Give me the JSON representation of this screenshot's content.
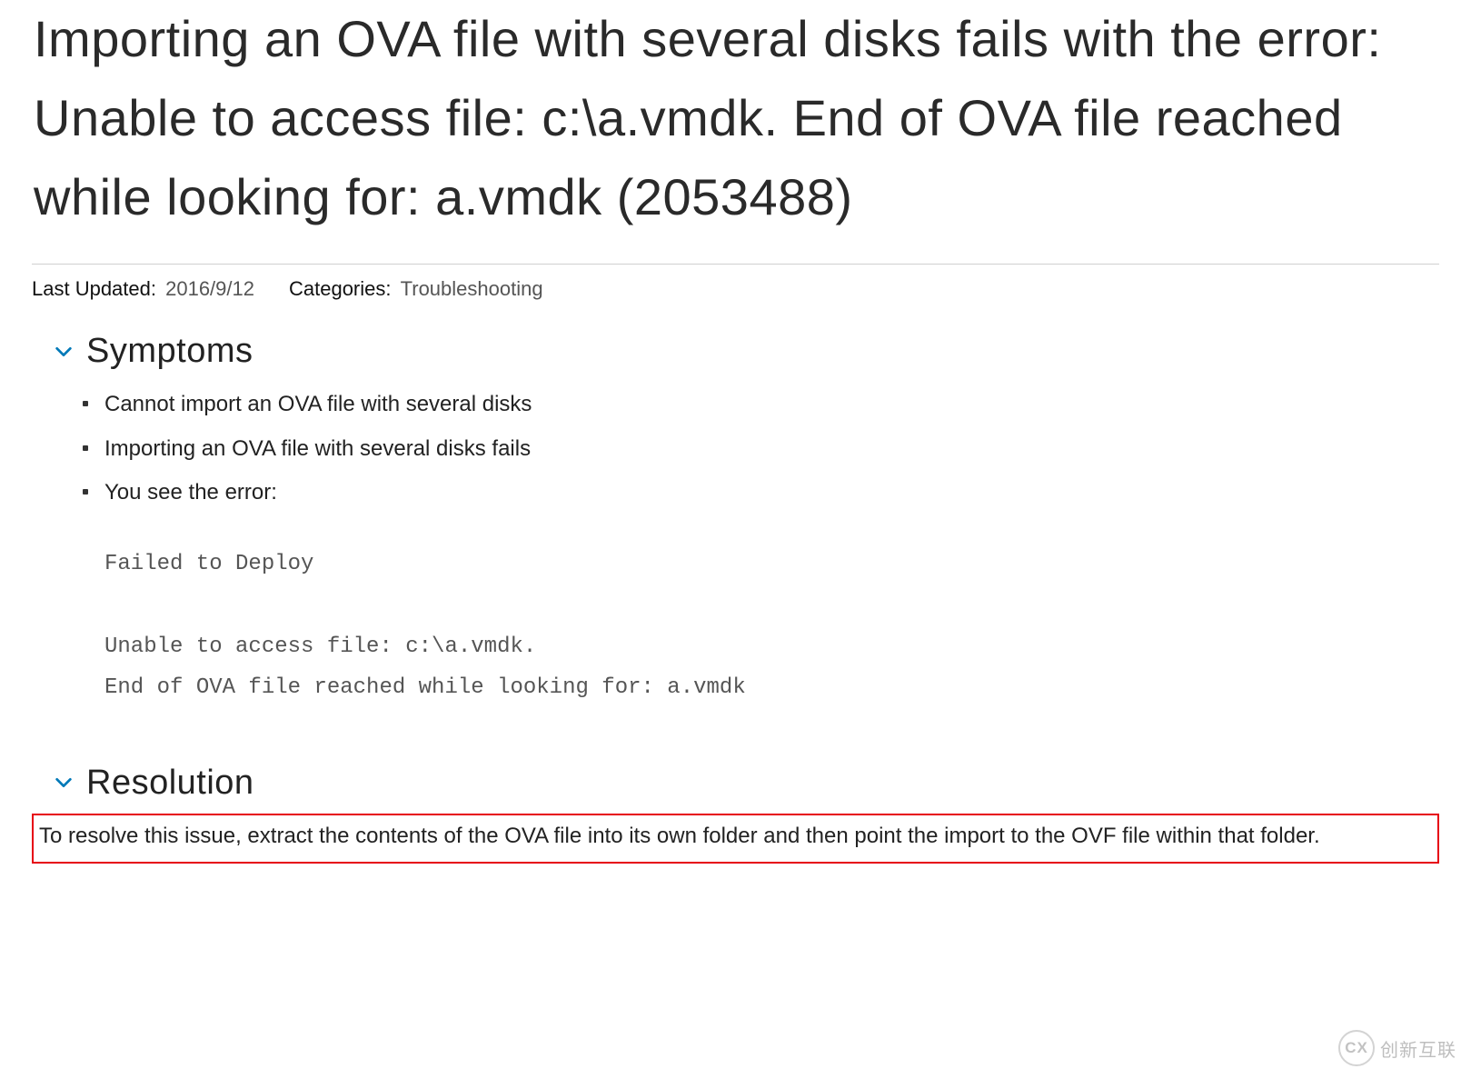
{
  "title": "Importing an OVA file with several disks fails with the error: Unable to access file: c:\\a.vmdk. End of OVA file reached while looking for: a.vmdk (2053488)",
  "meta": {
    "last_updated_label": "Last Updated:",
    "last_updated_value": "2016/9/12",
    "categories_label": "Categories:",
    "categories_value": "Troubleshooting"
  },
  "sections": {
    "symptoms": {
      "heading": "Symptoms",
      "bullets": [
        "Cannot import an OVA file with several disks",
        "Importing an OVA file with several disks fails",
        "You see the error:"
      ],
      "code": "Failed to Deploy\n\nUnable to access file: c:\\a.vmdk.\nEnd of OVA file reached while looking for: a.vmdk"
    },
    "resolution": {
      "heading": "Resolution",
      "body": "To resolve this issue, extract the contents of the OVA file into its own folder and then point the import to the OVF file within that folder."
    }
  },
  "watermark": {
    "badge": "CX",
    "text": "创新互联"
  }
}
